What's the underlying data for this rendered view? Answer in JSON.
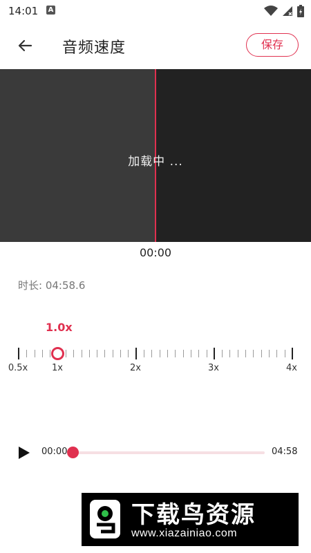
{
  "status_bar": {
    "time": "14:01",
    "notification_icon": "A",
    "icons": [
      "wifi-icon",
      "signal-icon",
      "battery-icon"
    ]
  },
  "app_bar": {
    "back_icon": "arrow-left-icon",
    "title": "音频速度",
    "save_label": "保存"
  },
  "waveform": {
    "loading_text": "加载中 ...",
    "current_time": "00:00"
  },
  "info": {
    "duration_text": "时长: 04:58.6"
  },
  "speed": {
    "current_label": "1.0x",
    "current_value": 1.0,
    "min": 0.5,
    "max": 4,
    "tick_labels": [
      "0.5x",
      "1x",
      "2x",
      "3x",
      "4x"
    ]
  },
  "player": {
    "start_time": "00:00",
    "end_time": "04:58",
    "progress": 0
  },
  "watermark": {
    "title": "下载鸟资源",
    "url": "www.xiazainiao.com"
  },
  "colors": {
    "accent": "#e0304f",
    "waveform_bg": "#222222",
    "waveform_played": "#3a3a3a"
  }
}
